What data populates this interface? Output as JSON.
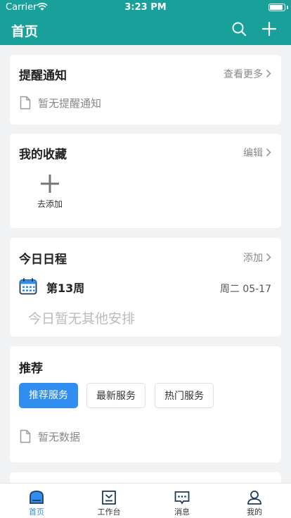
{
  "status_bar": {
    "carrier": "Carrier",
    "time": "3:23 PM",
    "battery_level": 0.9
  },
  "header": {
    "title": "首页",
    "search_icon": "search-icon",
    "add_icon": "plus-icon"
  },
  "reminders": {
    "title": "提醒通知",
    "action": "查看更多",
    "empty_text": "暂无提醒通知"
  },
  "favorites": {
    "title": "我的收藏",
    "action": "编辑",
    "add_label": "去添加"
  },
  "schedule": {
    "title": "今日日程",
    "action": "添加",
    "week": "第13周",
    "date": "周二 05-17",
    "empty_text": "今日暂无其他安排"
  },
  "recommend": {
    "title": "推荐",
    "tabs": [
      {
        "label": "推荐服务",
        "active": true
      },
      {
        "label": "最新服务",
        "active": false
      },
      {
        "label": "热门服务",
        "active": false
      }
    ],
    "empty_text": "暂无数据"
  },
  "tabbar": {
    "items": [
      {
        "label": "首页",
        "icon": "home-icon",
        "active": true
      },
      {
        "label": "工作台",
        "icon": "workbench-icon",
        "active": false
      },
      {
        "label": "消息",
        "icon": "message-icon",
        "active": false
      },
      {
        "label": "我的",
        "icon": "profile-icon",
        "active": false
      }
    ]
  },
  "colors": {
    "header": "#17a19a",
    "accent": "#2f8ef0",
    "background": "#f1f2f4"
  }
}
